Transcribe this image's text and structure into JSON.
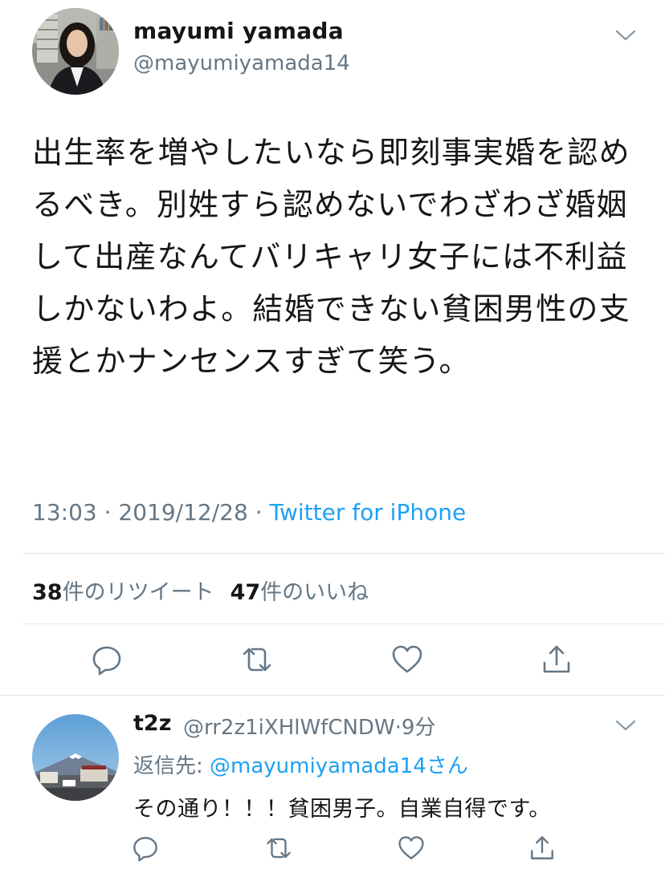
{
  "tweet": {
    "author_name": "mayumi yamada",
    "author_handle": "@mayumiyamada14",
    "text": "出生率を増やしたいなら即刻事実婚を認めるべき。別姓すら認めないでわざわざ婚姻して出産なんてバリキャリ女子には不利益しかないわよ。結婚できない貧困男性の支援とかナンセンスすぎて笑う。",
    "time": "13:03",
    "date": "2019/12/28",
    "separator": "·",
    "source": "Twitter for iPhone",
    "retweet_count": "38",
    "retweet_label": "件のリツイート",
    "like_count": "47",
    "like_label": "件のいいね"
  },
  "reply": {
    "author_name": "t2z",
    "author_handle": "@rr2z1iXHlWfCNDW",
    "separator": "·",
    "age": "9分",
    "reply_to_prefix": "返信先: ",
    "reply_to_mention": "@mayumiyamada14",
    "reply_to_suffix": "さん",
    "text": "その通り！！！貧困男子。自業自得です。"
  },
  "icons": {
    "reply": "reply-icon",
    "retweet": "retweet-icon",
    "like": "heart-icon",
    "share": "share-icon",
    "menu": "chevron-down-icon"
  },
  "colors": {
    "text": "#14171a",
    "secondary": "#657786",
    "link": "#1da1f2",
    "divider": "#e1e8ed"
  }
}
